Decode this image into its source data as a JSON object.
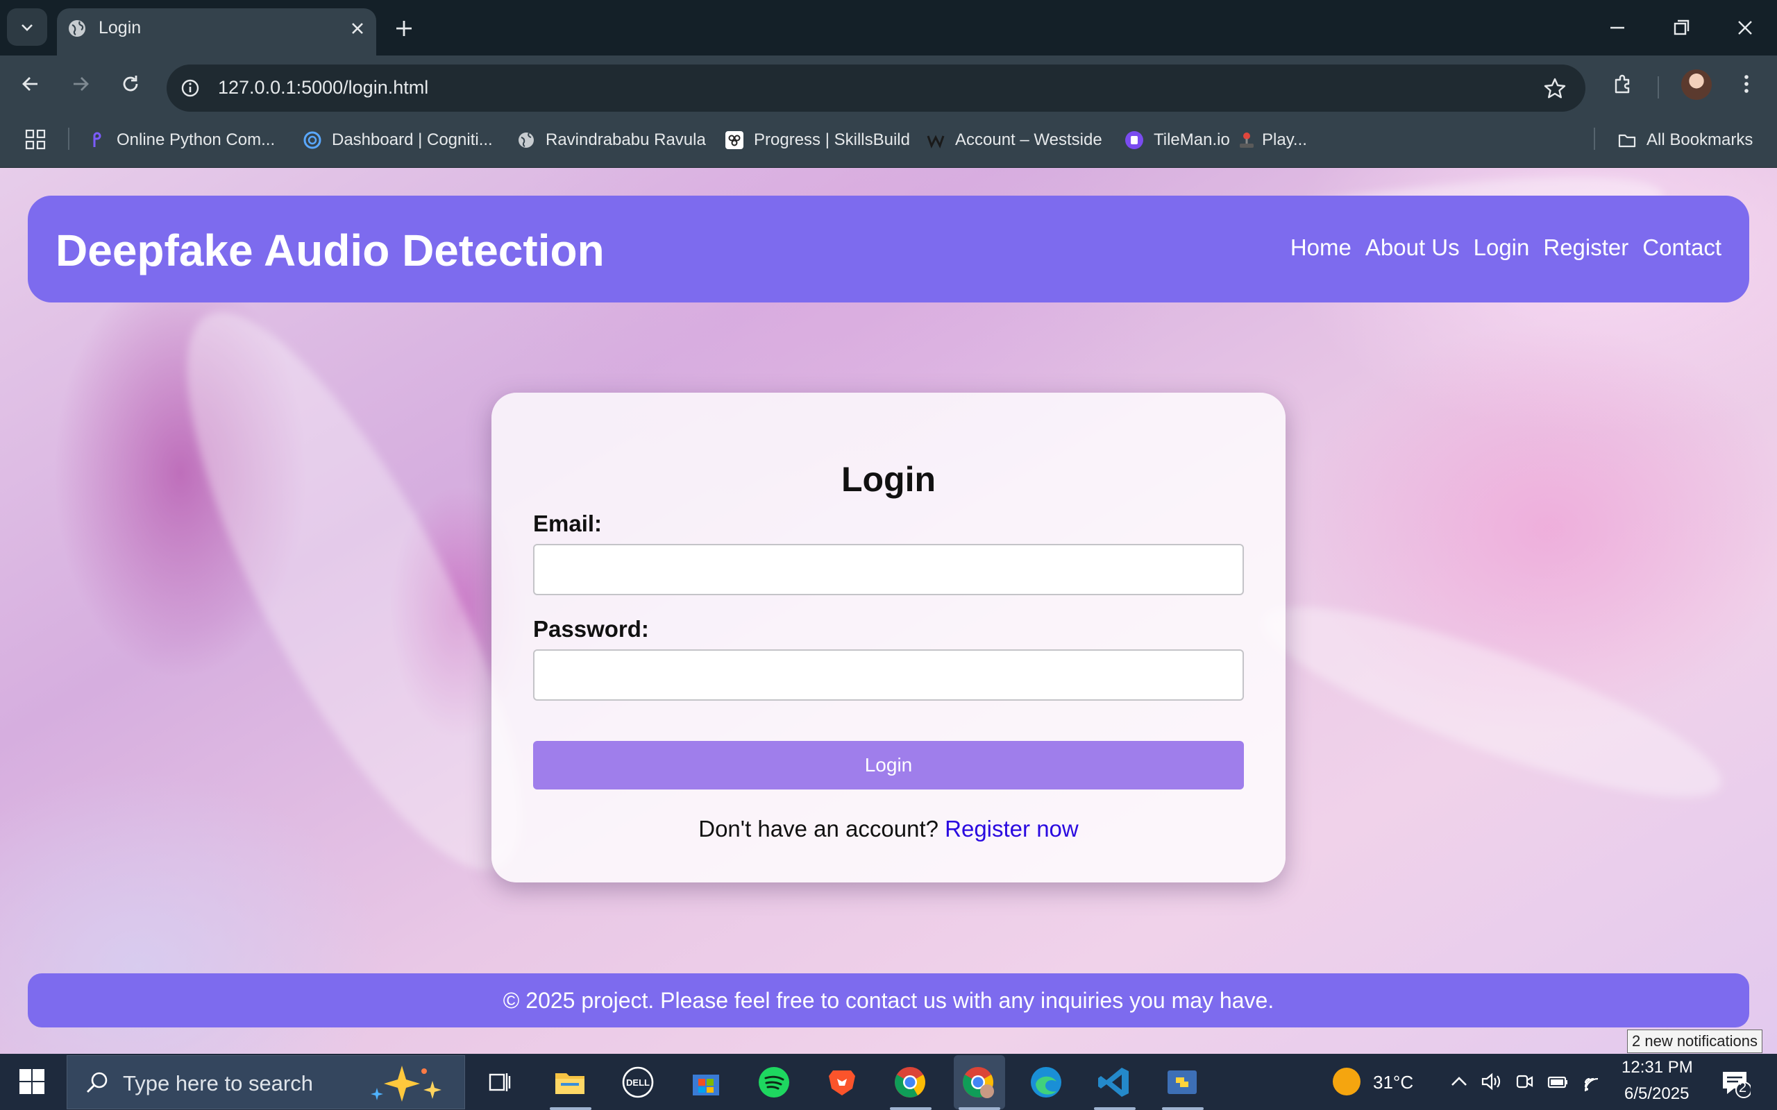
{
  "browser": {
    "tab_title": "Login",
    "url": "127.0.0.1:5000/login.html",
    "bookmarks": [
      {
        "label": "Online Python Com...",
        "icon": "python-logo-icon"
      },
      {
        "label": "Dashboard | Cogniti...",
        "icon": "cognitive-class-icon"
      },
      {
        "label": "Ravindrababu Ravula",
        "icon": "globe-icon"
      },
      {
        "label": "Progress | SkillsBuild",
        "icon": "skillsbuild-icon"
      },
      {
        "label": "Account – Westside",
        "icon": "westside-icon"
      },
      {
        "label": "TileMan.io",
        "icon": "tileman-icon"
      },
      {
        "label": "Play...",
        "icon": "joystick-icon"
      }
    ],
    "all_bookmarks": "All Bookmarks"
  },
  "site": {
    "title": "Deepfake Audio Detection",
    "nav": [
      "Home",
      "About Us",
      "Login",
      "Register",
      "Contact"
    ],
    "brand_color": "#7d6bee"
  },
  "login": {
    "heading": "Login",
    "email_label": "Email:",
    "email_value": "",
    "password_label": "Password:",
    "password_value": "",
    "button_label": "Login",
    "signup_prompt": "Don't have an account?",
    "signup_link": "Register now",
    "button_color": "#9f7eeb"
  },
  "footer": {
    "text": "© 2025 project. Please feel free to contact us with any inquiries you may have."
  },
  "notification_tooltip": "2 new notifications",
  "taskbar": {
    "search_placeholder": "Type here to search",
    "apps": [
      "task-view-icon",
      "file-explorer-icon",
      "dell-icon",
      "microsoft-store-icon",
      "spotify-icon",
      "brave-icon",
      "chrome-icon",
      "chrome-profile-icon",
      "edge-icon",
      "vscode-icon",
      "python-icon"
    ],
    "weather": "31°C",
    "time": "12:31 PM",
    "date": "6/5/2025",
    "notification_count": "2"
  }
}
